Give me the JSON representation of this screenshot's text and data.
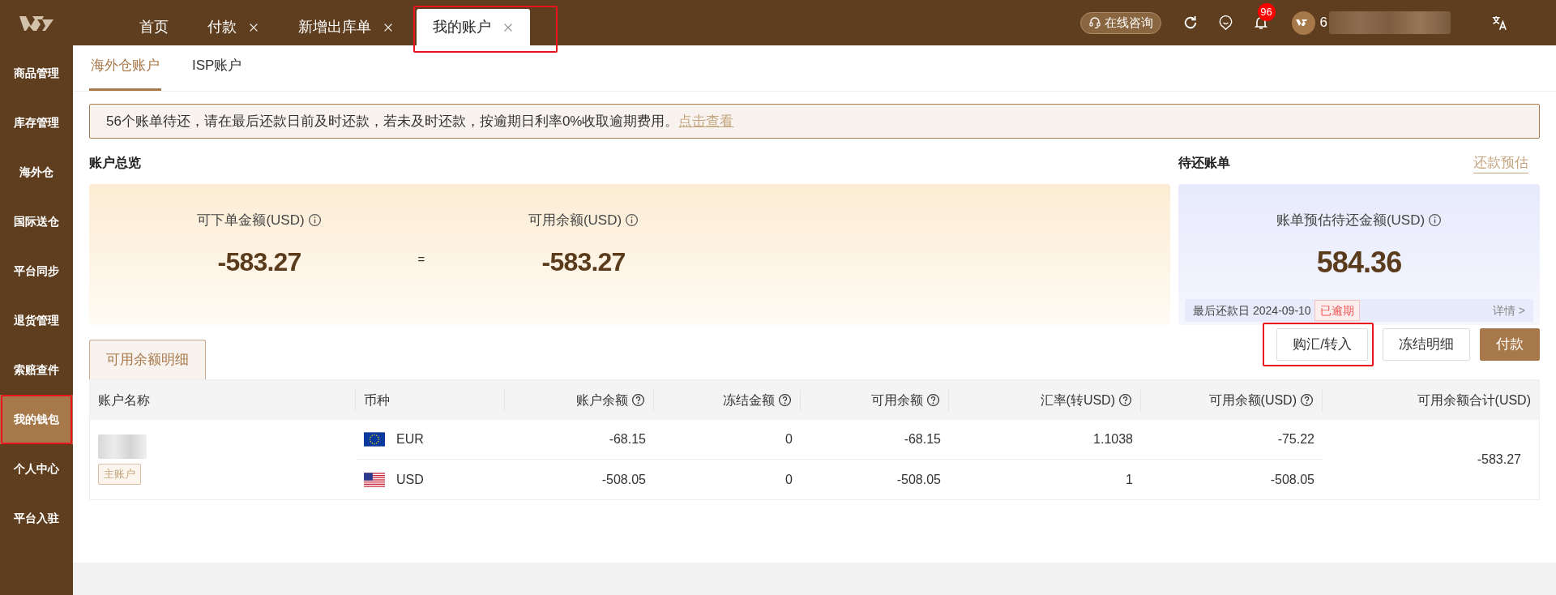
{
  "tabs": [
    {
      "label": "首页",
      "closable": false,
      "selected": false,
      "highlighted": false
    },
    {
      "label": "付款",
      "closable": true,
      "selected": false,
      "highlighted": false
    },
    {
      "label": "新增出库单",
      "closable": true,
      "selected": false,
      "highlighted": false
    },
    {
      "label": "我的账户",
      "closable": true,
      "selected": true,
      "highlighted": true
    }
  ],
  "header": {
    "consult_button": "在线咨询",
    "notification_count": "96",
    "user_name": "6"
  },
  "sidebar": {
    "items": [
      {
        "label": "商品管理",
        "selected": false,
        "highlighted": false
      },
      {
        "label": "库存管理",
        "selected": false,
        "highlighted": false
      },
      {
        "label": "海外仓",
        "selected": false,
        "highlighted": false
      },
      {
        "label": "国际送仓",
        "selected": false,
        "highlighted": false
      },
      {
        "label": "平台同步",
        "selected": false,
        "highlighted": false
      },
      {
        "label": "退货管理",
        "selected": false,
        "highlighted": false
      },
      {
        "label": "索赔查件",
        "selected": false,
        "highlighted": false
      },
      {
        "label": "我的钱包",
        "selected": true,
        "highlighted": true
      },
      {
        "label": "个人中心",
        "selected": false,
        "highlighted": false
      },
      {
        "label": "平台入驻",
        "selected": false,
        "highlighted": false
      }
    ]
  },
  "account_tabs": [
    {
      "label": "海外仓账户",
      "selected": true
    },
    {
      "label": "ISP账户",
      "selected": false
    }
  ],
  "alert": {
    "message": "56个账单待还，请在最后还款日前及时还款，若未及时还款，按逾期日利率0%收取逾期费用。",
    "link": "点击查看"
  },
  "overview": {
    "title": "账户总览",
    "orderable": {
      "label": "可下单金额(USD)",
      "value": "-583.27"
    },
    "operator": "=",
    "available": {
      "label": "可用余额(USD)",
      "value": "-583.27"
    }
  },
  "bills": {
    "title": "待还账单",
    "link": "还款预估",
    "label": "账单预估待还金额(USD)",
    "amount": "584.36",
    "due_label": "最后还款日",
    "due_date": "2024-09-10",
    "status": "已逾期",
    "details": "详情 >"
  },
  "detail_tab": {
    "label": "可用余额明细",
    "selected": true
  },
  "actions": [
    {
      "label": "购汇/转入",
      "kind": "outline",
      "highlighted": true
    },
    {
      "label": "冻结明细",
      "kind": "outline",
      "highlighted": false
    },
    {
      "label": "付款",
      "kind": "primary",
      "highlighted": false
    }
  ],
  "table": {
    "columns": [
      {
        "label": "账户名称",
        "help": false
      },
      {
        "label": "币种",
        "help": false
      },
      {
        "label": "账户余额",
        "help": true
      },
      {
        "label": "冻结金额",
        "help": true
      },
      {
        "label": "可用余额",
        "help": true
      },
      {
        "label": "汇率(转USD)",
        "help": true
      },
      {
        "label": "可用余额(USD)",
        "help": true
      },
      {
        "label": "可用余额合计(USD)",
        "help": false
      }
    ],
    "account_badge": "主账户",
    "rows": [
      {
        "currency": "EUR",
        "kind": "eu",
        "cells": [
          "-68.15",
          "0",
          "-68.15",
          "1.1038",
          "-75.22"
        ]
      },
      {
        "currency": "USD",
        "kind": "us",
        "cells": [
          "-508.05",
          "0",
          "-508.05",
          "1",
          "-508.05"
        ]
      }
    ],
    "total": "-583.27"
  }
}
